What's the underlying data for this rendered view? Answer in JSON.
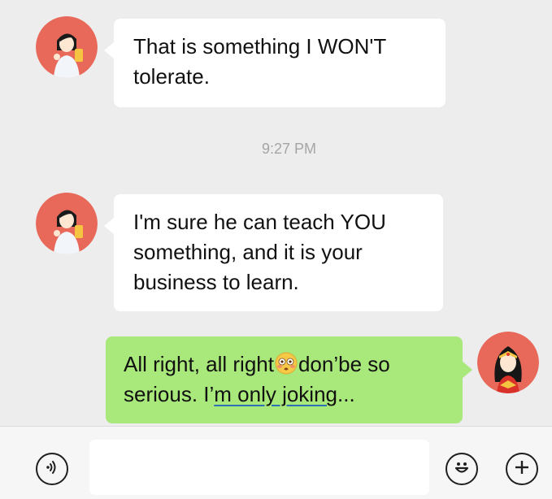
{
  "messages": [
    {
      "sender": "other",
      "text": "That is something I WON'T tolerate."
    },
    {
      "sender": "other",
      "text": "I'm sure he can teach YOU something, and it is your business to learn."
    },
    {
      "sender": "me",
      "text_before": "All right, all right",
      "text_after": "don’be so serious. I’",
      "text_underlined": "m only joking",
      "text_end": "...",
      "emoji": "flushed-face-emoji"
    }
  ],
  "timestamp": "9:27 PM",
  "input": {
    "value": "",
    "placeholder": ""
  },
  "icons": {
    "voice": "voice-icon",
    "emoji": "smiley-icon",
    "plus": "plus-icon"
  },
  "colors": {
    "background": "#ededed",
    "outgoing_bubble": "#a9e87a",
    "incoming_bubble": "#ffffff",
    "avatar_bg": "#e8695a"
  }
}
